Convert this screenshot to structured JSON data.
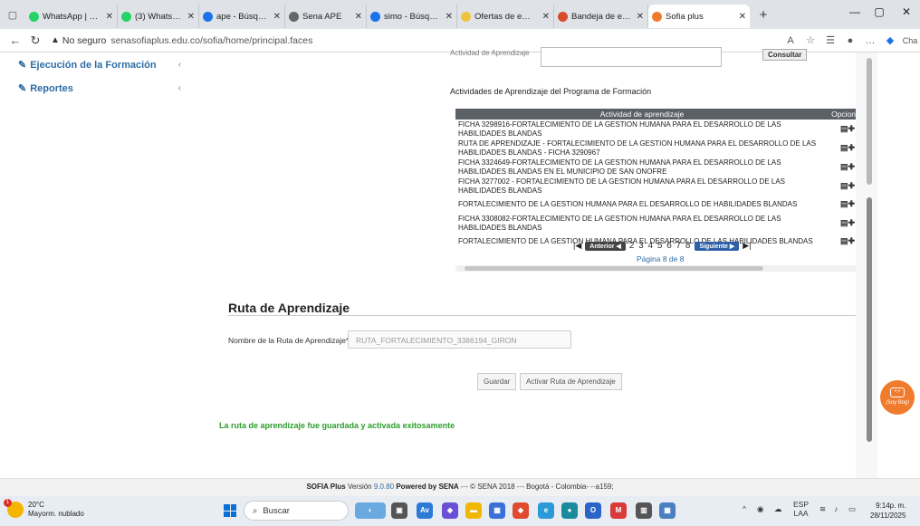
{
  "browser": {
    "tabs": [
      {
        "label": "WhatsApp | Mens",
        "color": "#25d366"
      },
      {
        "label": "(3) WhatsApp",
        "color": "#25d366"
      },
      {
        "label": "ape - Búsqueda",
        "color": "#1a73e8"
      },
      {
        "label": "Sena APE",
        "color": "#666666"
      },
      {
        "label": "simo - Búsqueda",
        "color": "#1a73e8"
      },
      {
        "label": "Ofertas de empleo",
        "color": "#f0c43a"
      },
      {
        "label": "Bandeja de entrad",
        "color": "#d94a2b"
      },
      {
        "label": "Sofia plus",
        "color": "#f07b2c"
      }
    ],
    "address": {
      "security": "No seguro",
      "url": "senasofiaplus.edu.co/sofia/home/principal.faces"
    },
    "overflow_label": "Cha"
  },
  "sidebar": {
    "items": [
      {
        "label": "Ejecución de la Formación"
      },
      {
        "label": "Reportes"
      }
    ]
  },
  "consult": {
    "label": "Actividad de Aprendizaje",
    "button": "Consultar"
  },
  "activities": {
    "title": "Actividades de Aprendizaje del Programa de Formación",
    "headers": [
      "Actividad de aprendizaje",
      "Opciones"
    ],
    "rows": [
      "FICHA 3298916-FORTALECIMIENTO DE LA GESTION HUMANA PARA EL DESARROLLO DE LAS HABILIDADES BLANDAS",
      "RUTA DE APRENDIZAJE - FORTALECIMIENTO DE LA GESTION HUMANA PARA EL DESARROLLO DE LAS HABILIDADES BLANDAS - FICHA 3290967",
      "FICHA 3324649-FORTALECIMIENTO DE LA GESTION HUMANA PARA EL DESARROLLO DE LAS HABILIDADES BLANDAS EN EL MUNICIPIO DE SAN ONOFRE",
      "FICHA 3277002 - FORTALECIMIENTO DE LA GESTION HUMANA PARA EL DESARROLLO DE LAS HABILIDADES BLANDAS",
      "FORTALECIMIENTO DE LA GESTION HUMANA PARA EL DESARROLLO DE HABILIDADES BLANDAS",
      "FICHA 3308082-FORTALECIMIENTO DE LA GESTION HUMANA PARA EL DESARROLLO DE LAS HABILIDADES BLANDAS",
      "FORTALECIMIENTO DE LA GESTION HUMANA PARA EL DESARROLLO DE LAS HABILIDADES BLANDAS"
    ],
    "pager": {
      "prev": "Anterior",
      "next": "Siguiente",
      "pages": "2 3 4 5 6 7 8",
      "status": "Página 8 de 8"
    }
  },
  "ruta": {
    "title": "Ruta de Aprendizaje",
    "name_label": "Nombre de la Ruta de Aprendizaje*",
    "name_value": "RUTA_FORTALECIMIENTO_3386194_GIRON",
    "save_button": "Guardar",
    "activate_button": "Activar Ruta de Aprendizaje",
    "success_message": "La ruta de aprendizaje fue guardada y activada exitosamente"
  },
  "mascot": {
    "label": "¡Soy Bog!"
  },
  "footer": {
    "product": "SOFIA Plus",
    "version_label": "Versión",
    "version": "9.0.80",
    "powered": "Powered by SENA",
    "rest": "-·- © SENA 2018 -·- Bogotá - Colombia- -·a159;"
  },
  "taskbar": {
    "temperature": "20°C",
    "weather": "Mayorm. nublado",
    "weather_badge": "1",
    "search": "Buscar",
    "language": "ESP",
    "layout": "LAA",
    "time": "9:14p. m.",
    "date": "28/11/2025"
  }
}
